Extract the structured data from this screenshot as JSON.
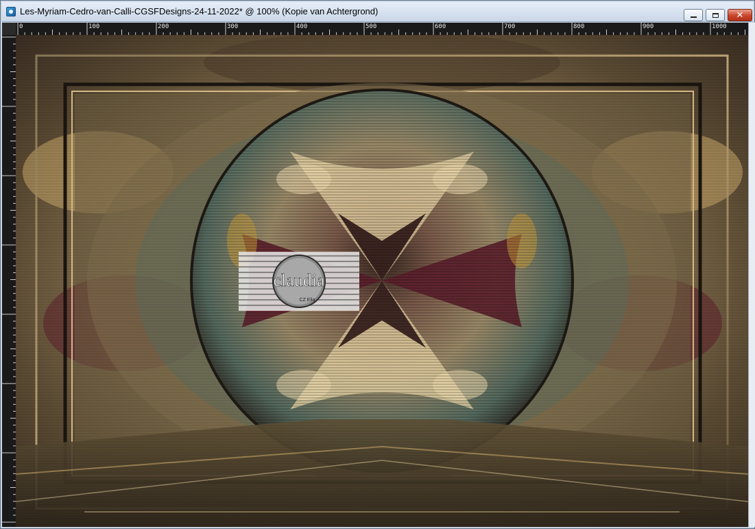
{
  "window": {
    "title": "Les-Myriam-Cedro-van-Calli-CGSFDesigns-24-11-2022* @ 100% (Kopie van Achtergrond)",
    "buttons": {
      "minimize": "minimize",
      "maximize": "maximize",
      "close": "✕"
    }
  },
  "ruler": {
    "top_ticks": [
      "0",
      "100",
      "200",
      "300",
      "400",
      "500",
      "600",
      "700",
      "800",
      "900",
      "1000"
    ]
  },
  "watermark": {
    "name": "claudia",
    "subtitle": "CZ Elia"
  },
  "colors": {
    "accent_gold": "#c9a86a",
    "deep_plum": "#5c1f2c",
    "teal": "#4f6f66",
    "cream": "#e8d3a4"
  }
}
